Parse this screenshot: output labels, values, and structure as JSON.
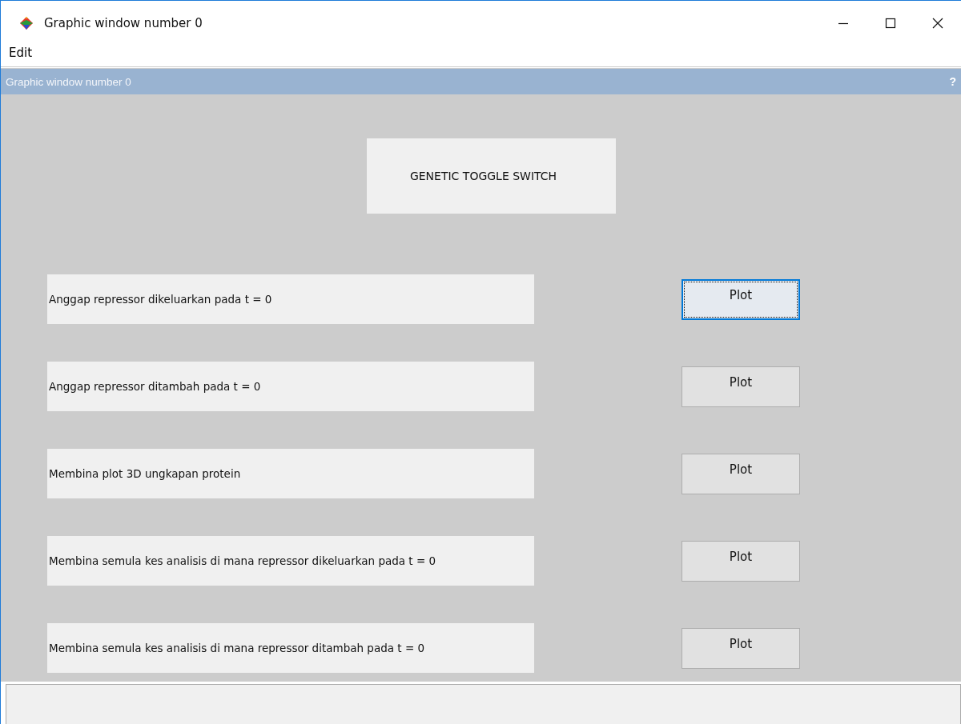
{
  "window": {
    "title": "Graphic window number 0"
  },
  "menu": [
    "Edit"
  ],
  "figure_bar": {
    "title": "Graphic window number 0",
    "help": "?"
  },
  "heading": "GENETIC TOGGLE SWITCH",
  "rows": [
    {
      "label": "Anggap repressor dikeluarkan pada t = 0",
      "button": "Plot",
      "focused": true
    },
    {
      "label": "Anggap repressor ditambah pada t = 0",
      "button": "Plot",
      "focused": false
    },
    {
      "label": "Membina plot 3D ungkapan protein",
      "button": "Plot",
      "focused": false
    },
    {
      "label": "Membina semula kes analisis di mana repressor dikeluarkan pada t = 0",
      "button": "Plot",
      "focused": false
    },
    {
      "label": "Membina semula kes analisis di mana repressor ditambah pada t = 0",
      "button": "Plot",
      "focused": false
    }
  ]
}
